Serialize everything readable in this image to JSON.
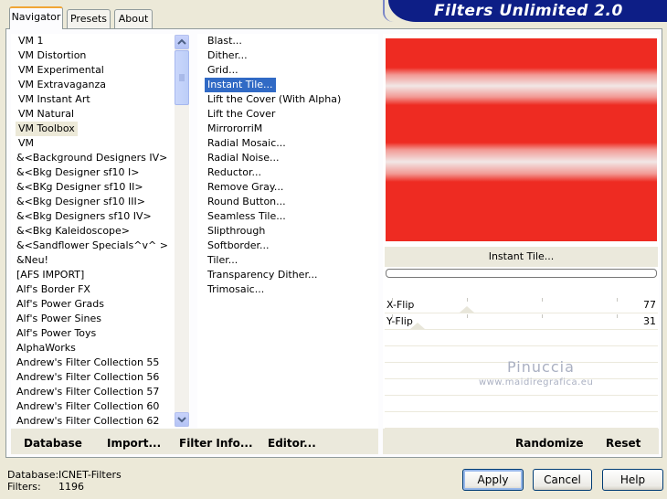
{
  "app": {
    "title": "Filters Unlimited 2.0"
  },
  "tabs": [
    "Navigator",
    "Presets",
    "About"
  ],
  "categories": [
    "VM 1",
    "VM Distortion",
    "VM Experimental",
    "VM Extravaganza",
    "VM Instant Art",
    "VM Natural",
    "VM Toolbox",
    "VM",
    "&<Background Designers IV>",
    "&<Bkg Designer sf10 I>",
    "&<BKg Designer sf10 II>",
    "&<Bkg Designer sf10 III>",
    "&<Bkg Designers sf10 IV>",
    "&<Bkg Kaleidoscope>",
    "&<Sandflower Specials^v^ >",
    "&Neu!",
    "[AFS IMPORT]",
    "Alf's Border FX",
    "Alf's Power Grads",
    "Alf's Power Sines",
    "Alf's Power Toys",
    "AlphaWorks",
    "Andrew's Filter Collection 55",
    "Andrew's Filter Collection 56",
    "Andrew's Filter Collection 57",
    "Andrew's Filter Collection 60",
    "Andrew's Filter Collection 62"
  ],
  "selected_category": "VM Toolbox",
  "filters": [
    "Blast...",
    "Dither...",
    "Grid...",
    "Instant Tile...",
    "Lift the Cover (With Alpha)",
    "Lift the Cover",
    "MirrororriM",
    "Radial Mosaic...",
    "Radial Noise...",
    "Reductor...",
    "Remove Gray...",
    "Round Button...",
    "Seamless Tile...",
    "Slipthrough",
    "Softborder...",
    "Tiler...",
    "Transparency Dither...",
    "Trimosaic..."
  ],
  "selected_filter": "Instant Tile...",
  "preview": {
    "filter_name": "Instant Tile...",
    "colors": {
      "stripe": "#ee2b22",
      "band": "#f2e7e6"
    },
    "watermark": {
      "name": "Pinuccia",
      "url": "www.maidiregrafica.eu"
    }
  },
  "params": [
    {
      "label": "X-Flip",
      "value": "77"
    },
    {
      "label": "Y-Flip",
      "value": "31"
    }
  ],
  "toolbar": {
    "database": "Database",
    "import": "Import...",
    "filter_info": "Filter Info...",
    "editor": "Editor...",
    "randomize": "Randomize",
    "reset": "Reset"
  },
  "status": {
    "database_label": "Database:",
    "database_value": "ICNET-Filters",
    "filters_label": "Filters:",
    "filters_value": "1196"
  },
  "dialog": {
    "apply": "Apply",
    "cancel": "Cancel",
    "help": "Help"
  }
}
